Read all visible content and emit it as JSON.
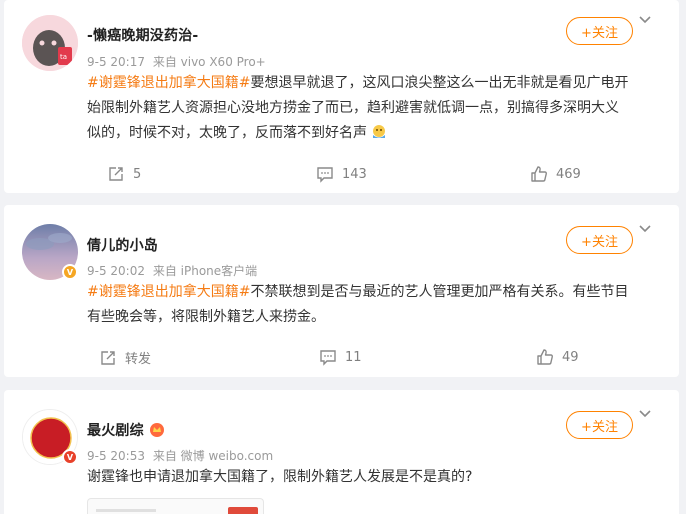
{
  "posts": [
    {
      "username": "-懒癌晚期没药治-",
      "timestamp": "9-5 20:17",
      "source": "来自 vivo X60 Pro+",
      "hashtag": "#谢霆锋退出加拿大国籍#",
      "lines": [
        "要想退早就退了，这风口浪尖整这么一出无非就是看见广电开",
        "始限制外籍艺人资源担心没地方捞金了而已，趋利避害就低调一点，别搞得多深明大义",
        "似的，时候不对，太晚了，反而落不到好名声"
      ],
      "follow_label": "+关注",
      "repost_count": "5",
      "comment_count": "143",
      "like_count": "469"
    },
    {
      "username": "倩儿的小岛",
      "timestamp": "9-5 20:02",
      "source": "来自 iPhone客户端",
      "hashtag": "#谢霆锋退出加拿大国籍#",
      "lines": [
        "不禁联想到是否与最近的艺人管理更加严格有关系。有些节目",
        "有些晚会等，将限制外籍艺人来捞金。"
      ],
      "follow_label": "+关注",
      "repost_label": "转发",
      "comment_count": "11",
      "like_count": "49"
    },
    {
      "username": "最火剧综",
      "timestamp": "9-5 20:53",
      "source": "来自 微博 weibo.com",
      "text": "谢霆锋也申请退加拿大国籍了，限制外籍艺人发展是不是真的?",
      "follow_label": "+关注"
    }
  ],
  "colors": {
    "accent": "#ff8200",
    "hashtag": "#f57c15",
    "background": "#f1f2f5"
  },
  "icons": [
    "repost-icon",
    "comment-icon",
    "like-icon",
    "chevron-down-icon",
    "verified-badge-icon"
  ]
}
